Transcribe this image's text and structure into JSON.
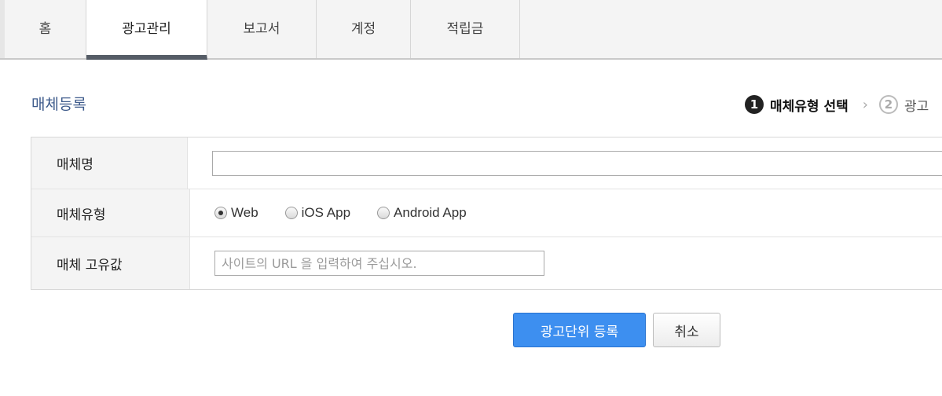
{
  "tabs": [
    {
      "label": "홈",
      "active": false
    },
    {
      "label": "광고관리",
      "active": true
    },
    {
      "label": "보고서",
      "active": false
    },
    {
      "label": "계정",
      "active": false
    },
    {
      "label": "적립금",
      "active": false
    }
  ],
  "section_title": "매체등록",
  "steps": [
    {
      "number": "1",
      "label": "매체유형 선택",
      "active": true
    },
    {
      "number": "2",
      "label": "광고",
      "active": false
    }
  ],
  "form": {
    "name_label": "매체명",
    "name_value": "",
    "type_label": "매체유형",
    "type_options": [
      {
        "label": "Web",
        "checked": true
      },
      {
        "label": "iOS App",
        "checked": false
      },
      {
        "label": "Android App",
        "checked": false
      }
    ],
    "unique_label": "매체 고유값",
    "unique_placeholder": "사이트의 URL 을 입력하여 주십시오.",
    "unique_value": ""
  },
  "buttons": {
    "register_label": "광고단위 등록",
    "cancel_label": "취소"
  },
  "colors": {
    "primary": "#3d8ff0",
    "title": "#3f5c8c",
    "active_tab_underline": "#555c66"
  }
}
